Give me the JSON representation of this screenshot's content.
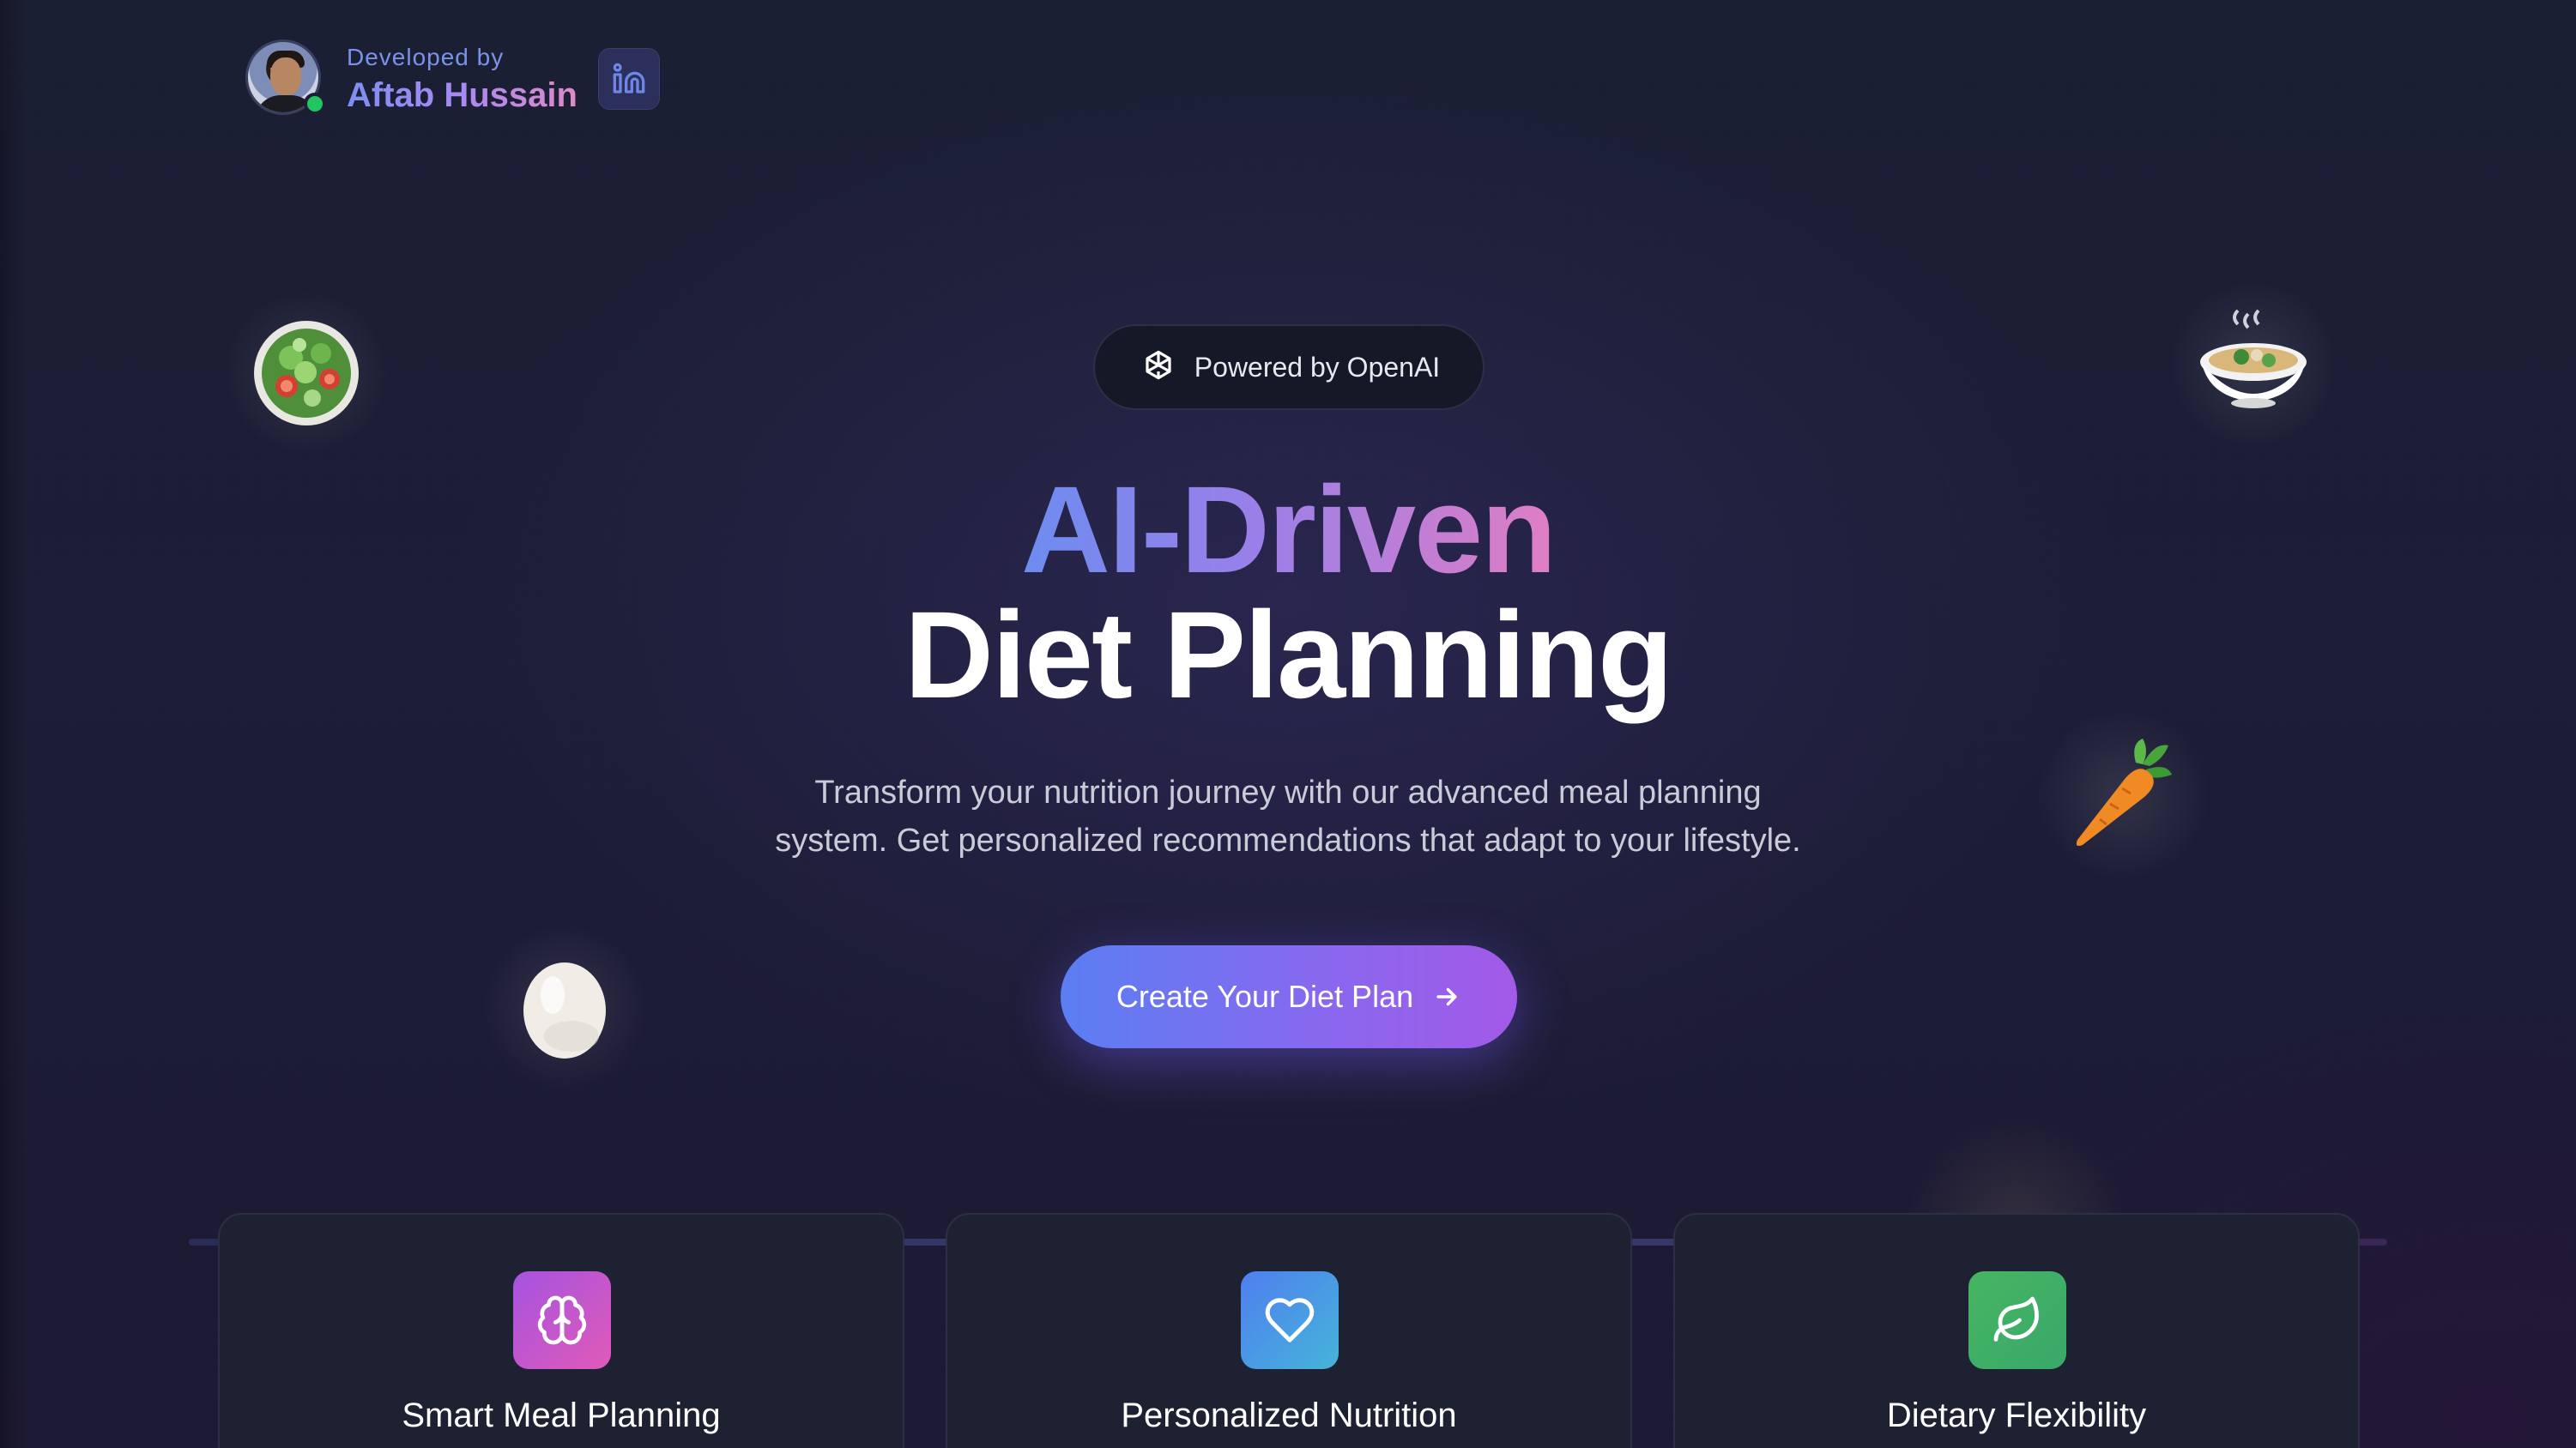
{
  "developer": {
    "label": "Developed by",
    "name": "Aftab Hussain",
    "social_icon": "linkedin-icon"
  },
  "floating_items": [
    "salad-icon",
    "soup-bowl-icon",
    "carrot-icon",
    "egg-icon"
  ],
  "badge": {
    "icon": "openai-icon",
    "text": "Powered by OpenAI"
  },
  "hero": {
    "title_line1": "AI-Driven",
    "title_line2": "Diet Planning",
    "subtitle_line1": "Transform your nutrition journey with our advanced meal planning",
    "subtitle_line2": "system. Get personalized recommendations that adapt to your lifestyle.",
    "cta_label": "Create Your Diet Plan",
    "cta_icon": "arrow-right-icon"
  },
  "features": [
    {
      "title": "Smart Meal Planning",
      "icon": "brain-icon",
      "color": "#c24fd6"
    },
    {
      "title": "Personalized Nutrition",
      "icon": "heart-icon",
      "color": "#4d8cf0"
    },
    {
      "title": "Dietary Flexibility",
      "icon": "leaf-icon",
      "color": "#3fbf6a"
    }
  ],
  "colors": {
    "background": "#1c1d36",
    "accent_blue": "#5b7ef2",
    "accent_purple": "#a35ae8",
    "online_status": "#22c55e"
  }
}
